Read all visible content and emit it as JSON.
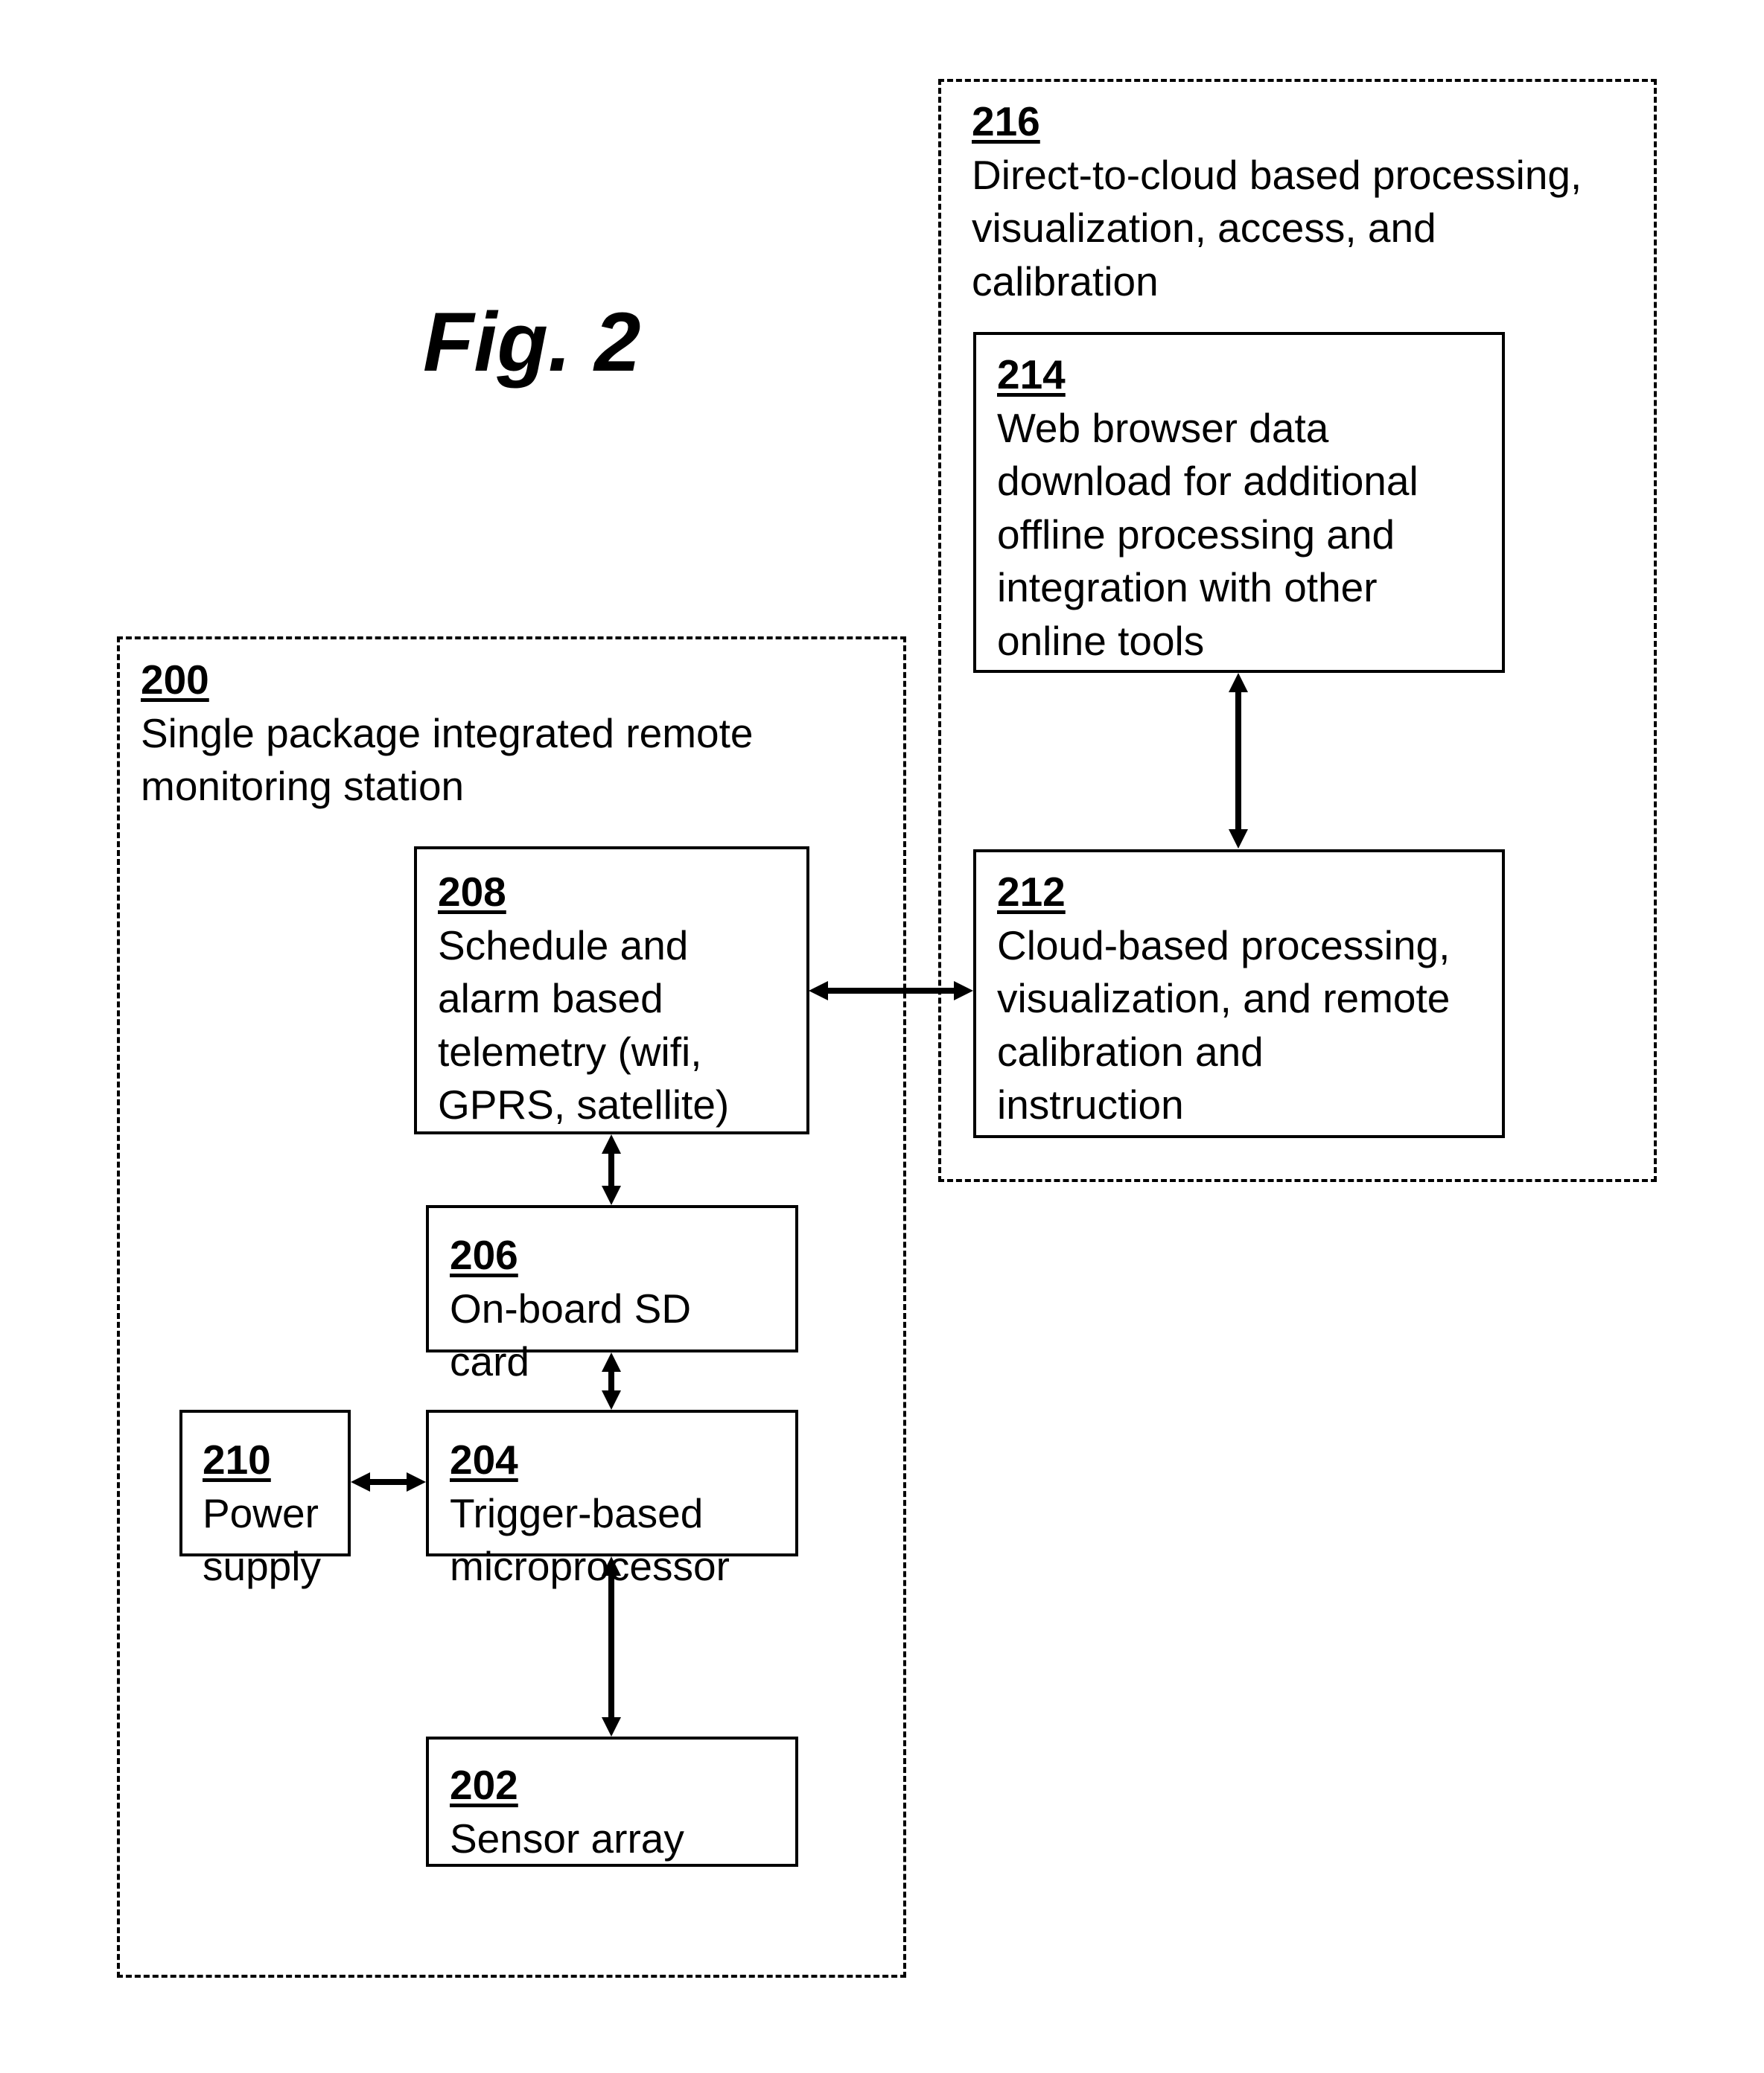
{
  "figure": {
    "title": "Fig. 2"
  },
  "groups": [
    {
      "id": "200",
      "lines": [
        "Single package integrated remote",
        "monitoring station"
      ]
    },
    {
      "id": "216",
      "lines": [
        "Direct-to-cloud based processing,",
        "visualization, access, and",
        "calibration"
      ]
    }
  ],
  "blocks": [
    {
      "id": "214",
      "lines": [
        "Web browser data",
        "download for additional",
        "offline processing and",
        "integration with other",
        "online tools"
      ]
    },
    {
      "id": "212",
      "lines": [
        "Cloud-based processing,",
        "visualization, and remote",
        "calibration and",
        "instruction"
      ]
    },
    {
      "id": "208",
      "lines": [
        "Schedule and",
        "alarm based",
        "telemetry (wifi,",
        "GPRS, satellite)"
      ]
    },
    {
      "id": "206",
      "lines": [
        "On-board SD",
        "card"
      ]
    },
    {
      "id": "210",
      "lines": [
        "Power",
        "supply"
      ]
    },
    {
      "id": "204",
      "lines": [
        "Trigger-based",
        "microprocessor"
      ]
    },
    {
      "id": "202",
      "lines": [
        "Sensor array"
      ]
    }
  ],
  "connections": [
    {
      "from": "214",
      "to": "212",
      "type": "bidirectional"
    },
    {
      "from": "208",
      "to": "212",
      "type": "bidirectional"
    },
    {
      "from": "208",
      "to": "206",
      "type": "bidirectional"
    },
    {
      "from": "206",
      "to": "204",
      "type": "bidirectional"
    },
    {
      "from": "210",
      "to": "204",
      "type": "bidirectional"
    },
    {
      "from": "204",
      "to": "202",
      "type": "bidirectional"
    }
  ]
}
